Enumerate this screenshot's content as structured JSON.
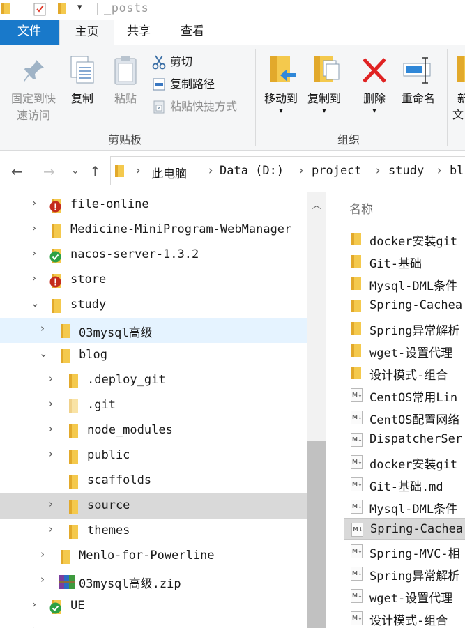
{
  "titlebar": {
    "title": "_posts"
  },
  "ribbon_tabs": [
    "文件",
    "主页",
    "共享",
    "查看"
  ],
  "ribbon": {
    "clipboard": {
      "pin_label_1": "固定到快",
      "pin_label_2": "速访问",
      "copy_label": "复制",
      "paste_label": "粘贴",
      "cut_label": "剪切",
      "copy_path_label": "复制路径",
      "paste_shortcut_label": "粘贴快捷方式",
      "group_label": "剪贴板"
    },
    "organize": {
      "move_to_label": "移动到",
      "copy_to_label": "复制到",
      "delete_label": "删除",
      "rename_label": "重命名",
      "group_label": "组织"
    },
    "new": {
      "label_1": "新",
      "label_2": "文"
    }
  },
  "address": {
    "crumbs": [
      "此电脑",
      "Data (D:)",
      "project",
      "study",
      "bl"
    ]
  },
  "tree": [
    {
      "label": "file-online",
      "badge": "error"
    },
    {
      "label": "Medicine-MiniProgram-WebManager",
      "badge": ""
    },
    {
      "label": "nacos-server-1.3.2",
      "badge": "ok"
    },
    {
      "label": "store",
      "badge": "error"
    },
    {
      "label": "study",
      "badge": ""
    },
    {
      "label": "03mysql高级",
      "badge": ""
    },
    {
      "label": "blog",
      "badge": ""
    },
    {
      "label": ".deploy_git",
      "badge": ""
    },
    {
      "label": ".git",
      "badge": ""
    },
    {
      "label": "node_modules",
      "badge": ""
    },
    {
      "label": "public",
      "badge": ""
    },
    {
      "label": "scaffolds",
      "badge": ""
    },
    {
      "label": "source",
      "badge": ""
    },
    {
      "label": "themes",
      "badge": ""
    },
    {
      "label": "Menlo-for-Powerline",
      "badge": ""
    },
    {
      "label": "03mysql高级.zip",
      "badge": ""
    },
    {
      "label": "UE",
      "badge": "ok"
    }
  ],
  "list": {
    "column_name": "名称",
    "items": [
      {
        "label": "docker安装git",
        "icon": "folder-icon"
      },
      {
        "label": "Git-基础",
        "icon": "folder-icon"
      },
      {
        "label": "Mysql-DML条件",
        "icon": "folder-icon"
      },
      {
        "label": "Spring-Cachea",
        "icon": "folder-icon"
      },
      {
        "label": "Spring异常解析",
        "icon": "folder-icon"
      },
      {
        "label": "wget-设置代理",
        "icon": "folder-icon"
      },
      {
        "label": "设计模式-组合",
        "icon": "folder-icon"
      },
      {
        "label": "CentOS常用Lin",
        "icon": "markdown-file-icon"
      },
      {
        "label": "CentOS配置网络",
        "icon": "markdown-file-icon"
      },
      {
        "label": "DispatcherSer",
        "icon": "markdown-file-icon"
      },
      {
        "label": "docker安装git",
        "icon": "markdown-file-icon"
      },
      {
        "label": "Git-基础.md",
        "icon": "markdown-file-icon"
      },
      {
        "label": "Mysql-DML条件",
        "icon": "markdown-file-icon"
      },
      {
        "label": "Spring-Cachea",
        "icon": "markdown-file-icon"
      },
      {
        "label": "Spring-MVC-相",
        "icon": "markdown-file-icon"
      },
      {
        "label": "Spring异常解析",
        "icon": "markdown-file-icon"
      },
      {
        "label": "wget-设置代理",
        "icon": "markdown-file-icon"
      },
      {
        "label": "设计模式-组合",
        "icon": "markdown-file-icon"
      }
    ]
  },
  "colors": {
    "accent": "#1979ca",
    "folder": "#f4c94d",
    "selected_row": "#d9d9d9",
    "hover_row": "#e5f3ff"
  }
}
